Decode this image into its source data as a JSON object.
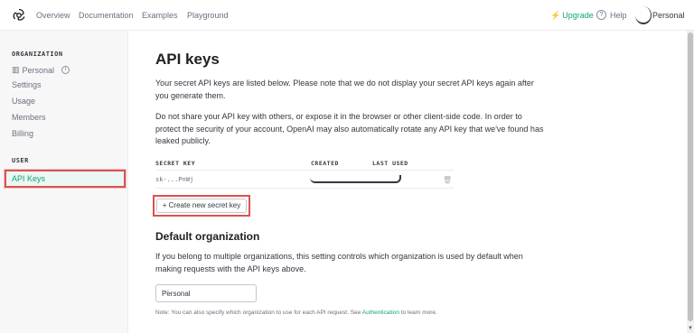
{
  "topnav": {
    "links": [
      "Overview",
      "Documentation",
      "Examples",
      "Playground"
    ],
    "upgrade": "Upgrade",
    "help": "Help",
    "account": "Personal"
  },
  "sidebar": {
    "org_heading": "ORGANIZATION",
    "org_name": "Personal",
    "org_items": [
      "Settings",
      "Usage",
      "Members",
      "Billing"
    ],
    "user_heading": "USER",
    "active_item": "API Keys"
  },
  "main": {
    "title": "API keys",
    "intro": "Your secret API keys are listed below. Please note that we do not display your secret API keys again after you generate them.",
    "warning": "Do not share your API key with others, or expose it in the browser or other client-side code. In order to protect the security of your account, OpenAI may also automatically rotate any API key that we've found has leaked publicly.",
    "table": {
      "headers": [
        "SECRET KEY",
        "CREATED",
        "LAST USED"
      ],
      "rows": [
        {
          "key": "sk-...PnWj"
        }
      ]
    },
    "create_button": "+ Create new secret key",
    "default_org_title": "Default organization",
    "default_org_desc": "If you belong to multiple organizations, this setting controls which organization is used by default when making requests with the API keys above.",
    "select_value": "Personal",
    "note_prefix": "Note: You can also specify which organization to use for each API request. See ",
    "note_link": "Authentication",
    "note_suffix": " to learn more."
  },
  "colors": {
    "accent": "#10a37f",
    "highlight": "#d9534f"
  }
}
